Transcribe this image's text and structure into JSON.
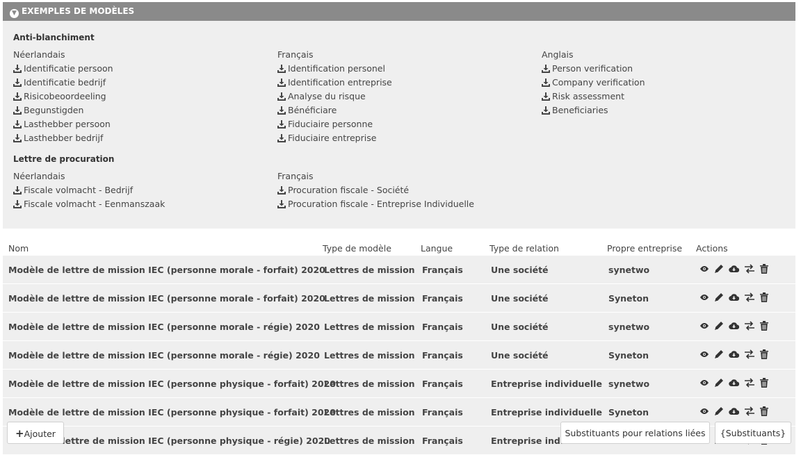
{
  "panel": {
    "title": "EXEMPLES DE MODÈLES",
    "sections": [
      {
        "title": "Anti-blanchiment",
        "columns": [
          {
            "language": "Néerlandais",
            "items": [
              "Identificatie persoon",
              "Identificatie bedrijf",
              "Risicobeoordeeling",
              "Begunstigden",
              "Lasthebber persoon",
              "Lasthebber bedrijf"
            ]
          },
          {
            "language": "Français",
            "items": [
              "Identification personel",
              "Identification entreprise",
              "Analyse du risque",
              "Bénéficiare",
              "Fiduciaire personne",
              "Fiduciaire entreprise"
            ]
          },
          {
            "language": "Anglais",
            "items": [
              "Person verification",
              "Company verification",
              "Risk assessment",
              "Beneficiaries"
            ]
          }
        ]
      },
      {
        "title": "Lettre de procuration",
        "columns": [
          {
            "language": "Néerlandais",
            "items": [
              "Fiscale volmacht - Bedrijf",
              "Fiscale volmacht - Eenmanszaak"
            ]
          },
          {
            "language": "Français",
            "items": [
              "Procuration fiscale - Société",
              "Procuration fiscale - Entreprise Individuelle"
            ]
          }
        ]
      }
    ]
  },
  "table": {
    "headers": [
      "Nom",
      "Type de modèle",
      "Langue",
      "Type de relation",
      "Propre entreprise",
      "Actions"
    ],
    "rows": [
      [
        "Modèle de lettre de mission IEC (personne morale - forfait) 2020",
        "Lettres de mission",
        "Français",
        "Une société",
        "synetwo"
      ],
      [
        "Modèle de lettre de mission IEC (personne morale - forfait) 2020",
        "Lettres de mission",
        "Français",
        "Une société",
        "Syneton"
      ],
      [
        "Modèle de lettre de mission IEC (personne morale - régie) 2020",
        "Lettres de mission",
        "Français",
        "Une société",
        "synetwo"
      ],
      [
        "Modèle de lettre de mission IEC (personne morale - régie) 2020",
        "Lettres de mission",
        "Français",
        "Une société",
        "Syneton"
      ],
      [
        "Modèle de lettre de mission IEC (personne physique - forfait) 2020",
        "Lettres de mission",
        "Français",
        "Entreprise individuelle",
        "synetwo"
      ],
      [
        "Modèle de lettre de mission IEC (personne physique - forfait) 2020",
        "Lettres de mission",
        "Français",
        "Entreprise individuelle",
        "Syneton"
      ],
      [
        "Modèle de lettre de mission IEC (personne physique - régie) 2020",
        "Lettres de mission",
        "Français",
        "Entreprise individuelle",
        ""
      ]
    ]
  },
  "buttons": {
    "add": "Ajouter",
    "substitutes_related": "Substituants pour relations liées",
    "substitutes": "{Substituants}"
  },
  "icons": [
    "chevron-down-icon",
    "download-icon",
    "eye-icon",
    "pencil-icon",
    "cloud-download-icon",
    "exchange-icon",
    "trash-icon",
    "plus-icon"
  ]
}
